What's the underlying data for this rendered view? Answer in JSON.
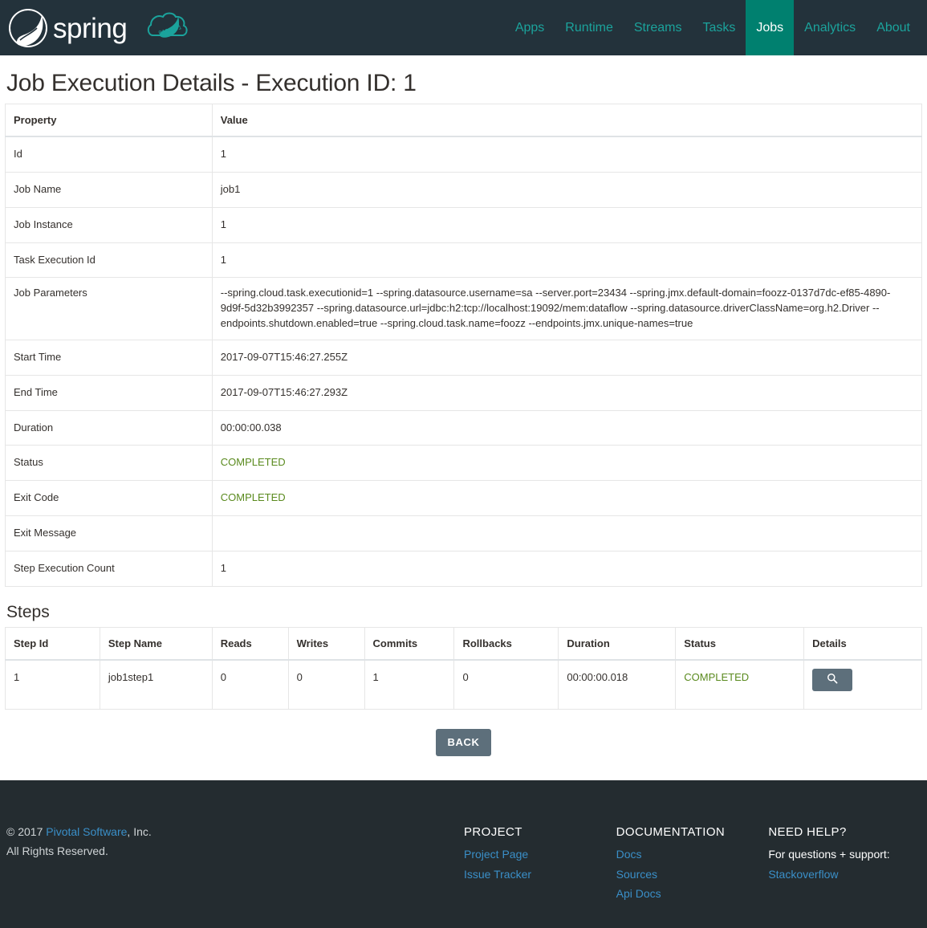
{
  "brand": {
    "name": "spring",
    "logo_icon": "spring-leaf-logo",
    "cloud_icon": "spring-cloud-dataflow-icon",
    "cloud_digits": "0101101"
  },
  "nav": {
    "items": [
      {
        "label": "Apps",
        "active": false
      },
      {
        "label": "Runtime",
        "active": false
      },
      {
        "label": "Streams",
        "active": false
      },
      {
        "label": "Tasks",
        "active": false
      },
      {
        "label": "Jobs",
        "active": true
      },
      {
        "label": "Analytics",
        "active": false
      },
      {
        "label": "About",
        "active": false
      }
    ]
  },
  "page": {
    "title": "Job Execution Details - Execution ID: 1",
    "steps_title": "Steps",
    "back_label": "BACK"
  },
  "properties_table": {
    "headers": [
      "Property",
      "Value"
    ],
    "rows": [
      {
        "property": "Id",
        "value": "1",
        "status": false
      },
      {
        "property": "Job Name",
        "value": "job1",
        "status": false
      },
      {
        "property": "Job Instance",
        "value": "1",
        "status": false
      },
      {
        "property": "Task Execution Id",
        "value": "1",
        "status": false
      },
      {
        "property": "Job Parameters",
        "value": "--spring.cloud.task.executionid=1 --spring.datasource.username=sa --server.port=23434 --spring.jmx.default-domain=foozz-0137d7dc-ef85-4890-9d9f-5d32b3992357 --spring.datasource.url=jdbc:h2:tcp://localhost:19092/mem:dataflow --spring.datasource.driverClassName=org.h2.Driver --endpoints.shutdown.enabled=true --spring.cloud.task.name=foozz --endpoints.jmx.unique-names=true",
        "status": false
      },
      {
        "property": "Start Time",
        "value": "2017-09-07T15:46:27.255Z",
        "status": false
      },
      {
        "property": "End Time",
        "value": "2017-09-07T15:46:27.293Z",
        "status": false
      },
      {
        "property": "Duration",
        "value": "00:00:00.038",
        "status": false
      },
      {
        "property": "Status",
        "value": "COMPLETED",
        "status": true
      },
      {
        "property": "Exit Code",
        "value": "COMPLETED",
        "status": true
      },
      {
        "property": "Exit Message",
        "value": "",
        "status": false
      },
      {
        "property": "Step Execution Count",
        "value": "1",
        "status": false
      }
    ]
  },
  "steps_table": {
    "headers": [
      "Step Id",
      "Step Name",
      "Reads",
      "Writes",
      "Commits",
      "Rollbacks",
      "Duration",
      "Status",
      "Details"
    ],
    "rows": [
      {
        "step_id": "1",
        "step_name": "job1step1",
        "reads": "0",
        "writes": "0",
        "commits": "1",
        "rollbacks": "0",
        "duration": "00:00:00.018",
        "status": "COMPLETED",
        "details_icon": "search-icon"
      }
    ]
  },
  "footer": {
    "copyright_prefix": "© 2017 ",
    "copyright_link": "Pivotal Software",
    "copyright_suffix": ", Inc.",
    "rights": "All Rights Reserved.",
    "columns": [
      {
        "heading": "PROJECT",
        "links": [
          "Project Page",
          "Issue Tracker"
        ],
        "static": []
      },
      {
        "heading": "DOCUMENTATION",
        "links": [
          "Docs",
          "Sources",
          "Api Docs"
        ],
        "static": []
      },
      {
        "heading": "NEED HELP?",
        "links": [
          "Stackoverflow"
        ],
        "static": [
          "For questions + support:"
        ]
      }
    ]
  },
  "colors": {
    "header_bg": "#23323b",
    "nav_link": "#1ba39c",
    "nav_active_bg": "#00806f",
    "status_completed": "#5a8a1e",
    "button_bg": "#5d6f7b",
    "footer_bg": "#242c30",
    "footer_link": "#3a8fc8"
  }
}
